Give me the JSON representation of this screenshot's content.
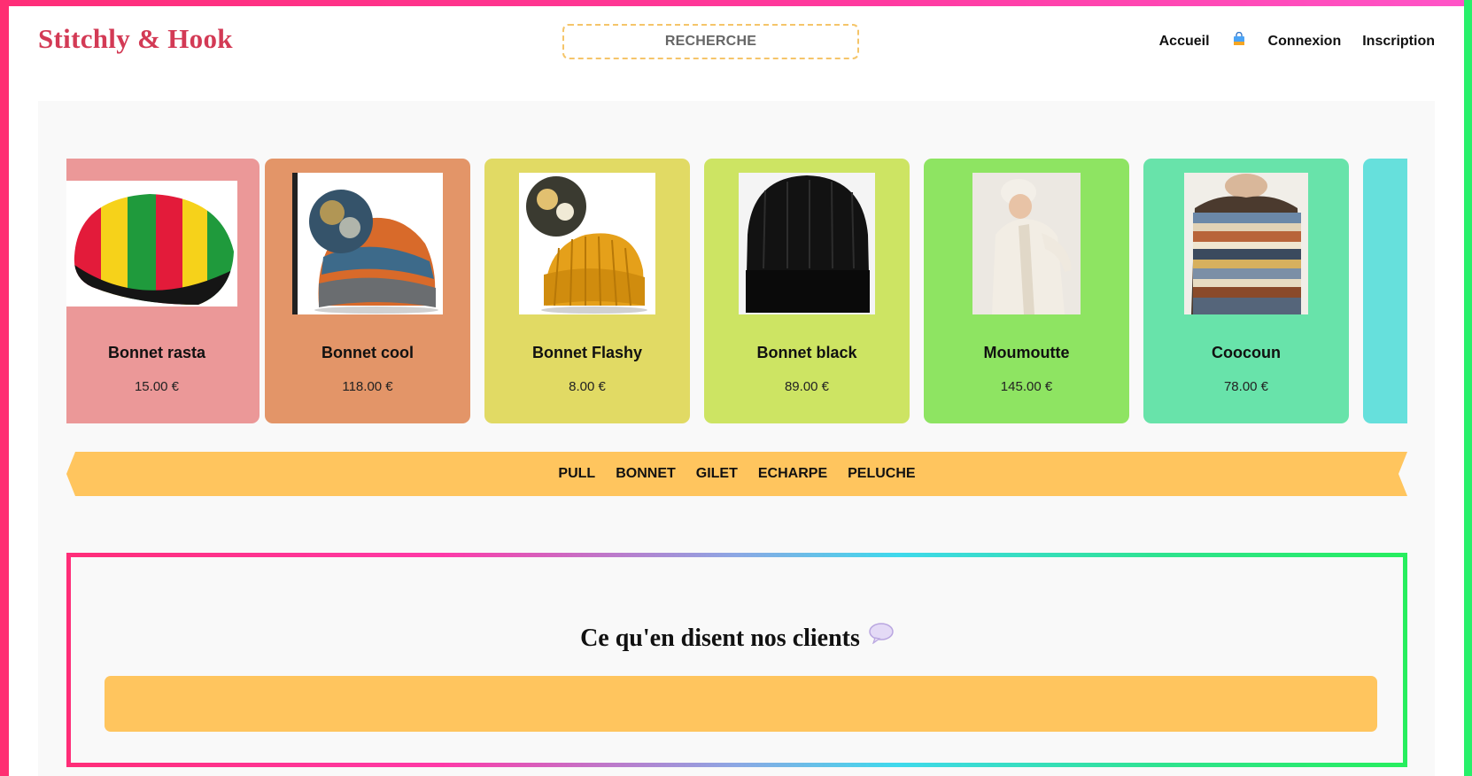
{
  "brand": {
    "name": "Stitchly & Hook"
  },
  "search": {
    "placeholder": "RECHERCHE"
  },
  "nav": {
    "home": "Accueil",
    "cart_icon": "shopping-bag-icon",
    "login": "Connexion",
    "signup": "Inscription"
  },
  "products": [
    {
      "name": "Bonnet rasta",
      "price": "15.00 €",
      "color": "#eb9898"
    },
    {
      "name": "Bonnet cool",
      "price": "118.00 €",
      "color": "#e39568"
    },
    {
      "name": "Bonnet Flashy",
      "price": "8.00 €",
      "color": "#e1da64"
    },
    {
      "name": "Bonnet black",
      "price": "89.00 €",
      "color": "#cde463"
    },
    {
      "name": "Moumoutte",
      "price": "145.00 €",
      "color": "#8ee462"
    },
    {
      "name": "Coocoun",
      "price": "78.00 €",
      "color": "#68e3aa"
    }
  ],
  "categories": [
    "PULL",
    "BONNET",
    "GILET",
    "ECHARPE",
    "PELUCHE"
  ],
  "testimonials": {
    "title": "Ce qu'en disent nos clients",
    "icon": "speech-bubble-icon"
  },
  "colors": {
    "brand": "#d33a55",
    "accent": "#ffc55e",
    "next_card": "#66e0dc"
  }
}
